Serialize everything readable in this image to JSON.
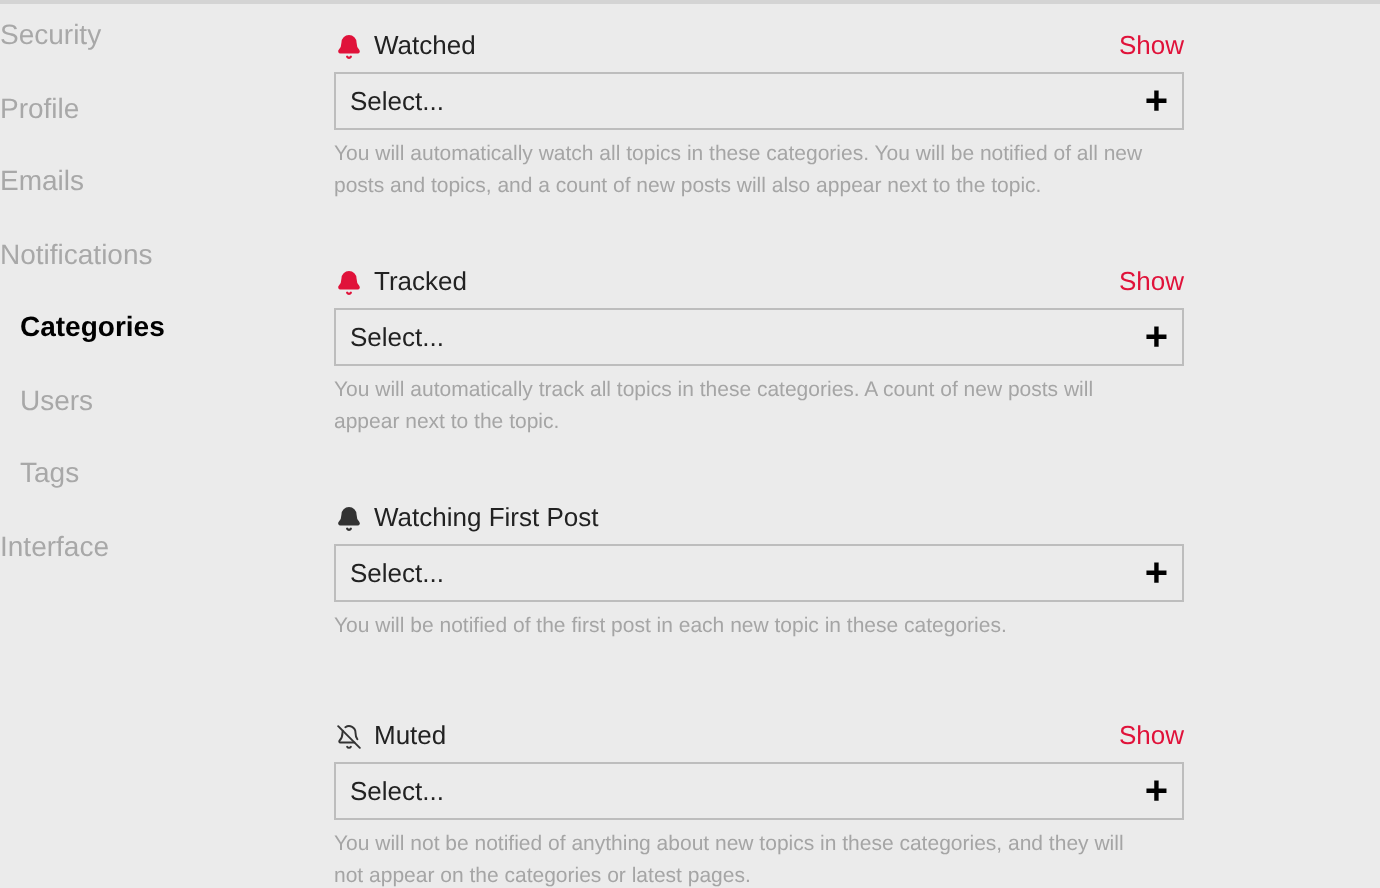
{
  "sidebar": {
    "items": [
      {
        "label": "Security",
        "selected": false
      },
      {
        "label": "Profile",
        "selected": false
      },
      {
        "label": "Emails",
        "selected": false
      },
      {
        "label": "Notifications",
        "selected": false,
        "children": [
          {
            "label": "Categories",
            "selected": true
          },
          {
            "label": "Users",
            "selected": false
          },
          {
            "label": "Tags",
            "selected": false
          }
        ]
      },
      {
        "label": "Interface",
        "selected": false
      }
    ]
  },
  "sections": [
    {
      "title": "Watched",
      "kind": "watched",
      "color": "#e0123a",
      "show": "Show",
      "placeholder": "Select...",
      "add": "+",
      "hint": "You will automatically watch all topics in these categories. You will be notified of all new posts and topics, and a count of new posts will also appear next to the topic."
    },
    {
      "title": "Tracked",
      "kind": "tracked",
      "color": "#e0123a",
      "show": "Show",
      "placeholder": "Select...",
      "add": "+",
      "hint": "You will automatically track all topics in these categories. A count of new posts will appear next to the topic."
    },
    {
      "title": "Watching First Post",
      "kind": "first-post",
      "color": "#333333",
      "placeholder": "Select...",
      "add": "+",
      "hint": "You will be notified of the first post in each new topic in these categories."
    },
    {
      "title": "Muted",
      "kind": "muted",
      "color": "#333333",
      "show": "Show",
      "placeholder": "Select...",
      "add": "+",
      "hint": "You will not be notified of anything about new topics in these categories, and they will not appear on the categories or latest pages."
    }
  ]
}
